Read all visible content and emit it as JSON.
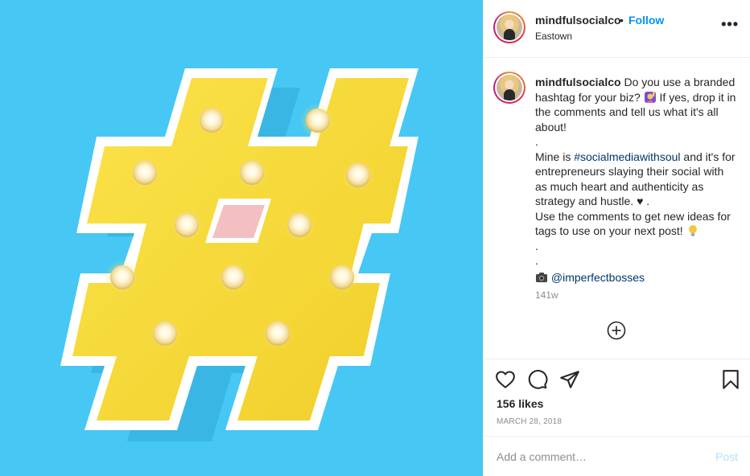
{
  "post": {
    "author": "mindfulsocialco",
    "separator": "•",
    "follow_label": "Follow",
    "location": "Eastown",
    "more_label": "•••",
    "caption": {
      "username": "mindfulsocialco",
      "line1": "Do you use a branded hashtag for your biz?",
      "line1b": "If yes, drop it in the comments and tell us what it's all about!",
      "dot1": ".",
      "mine_prefix": "Mine is ",
      "hashtag": "#socialmediawithsoul",
      "mine_suffix": " and it's for entrepreneurs slaying their social with as much heart and authenticity as strategy and hustle. ♥ .",
      "line3": "Use the comments to get new ideas for tags to use on your next post!",
      "dot2": ".",
      "dot3": ".",
      "credit_handle": "@imperfectbosses"
    },
    "time_ago": "141w",
    "likes": "156 likes",
    "date": "MARCH 28, 2018",
    "comment_placeholder": "Add a comment…",
    "post_label": "Post"
  },
  "colors": {
    "photo_background": "#47c7f4",
    "hashtag_yellow": "#f7dc3a",
    "link_blue": "#0095f6",
    "hashtag_link": "#00376b"
  }
}
